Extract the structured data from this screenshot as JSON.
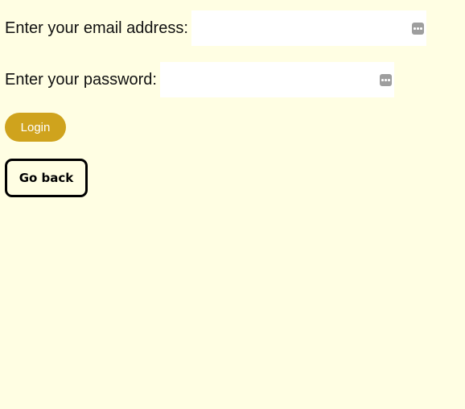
{
  "form": {
    "email_label": "Enter your email address:",
    "email_value": "",
    "email_placeholder": "",
    "password_label": "Enter your password:",
    "password_value": "",
    "password_placeholder": "",
    "autofill_icon": "password-manager-icon"
  },
  "buttons": {
    "login_label": "Login",
    "go_back_label": "Go back"
  },
  "colors": {
    "background": "#fffee3",
    "login_button": "#cfa31d",
    "input_background": "#ffffff",
    "go_back_border": "#000000"
  }
}
